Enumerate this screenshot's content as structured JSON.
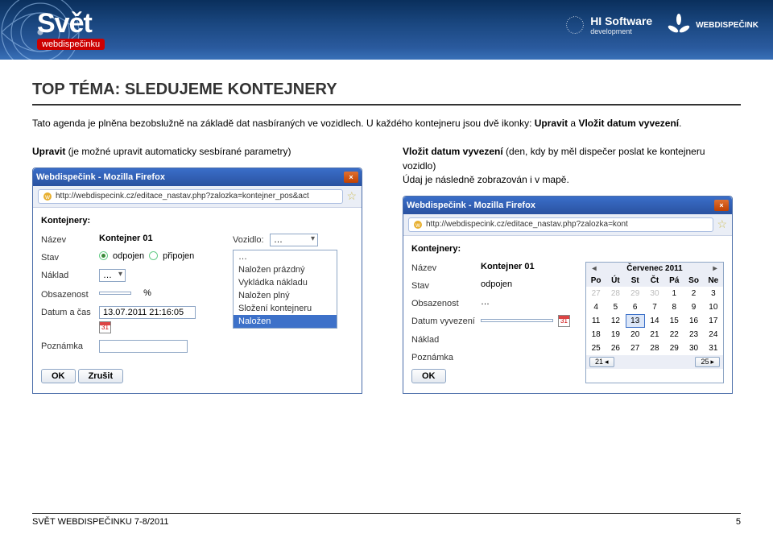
{
  "banner": {
    "brand_main": "Svět",
    "brand_sub": "webdispečinku",
    "hi_software": "HI Software",
    "hi_software_sub": "development",
    "webdispecink": "WEBDISPEČINK"
  },
  "page": {
    "title": "TOP TÉMA: SLEDUJEME KONTEJNERY",
    "intro_1": "Tato agenda je plněna bezobslužně na základě dat nasbíraných ve vozidlech. U každého kontejneru jsou dvě ikonky: ",
    "intro_b1": "Upravit",
    "intro_mid": " a ",
    "intro_b2": "Vložit datum vyvezení",
    "intro_end": "."
  },
  "left": {
    "heading_b": "Upravit",
    "heading_rest": " (je možné upravit automaticky sesbírané parametry)",
    "window_title": "Webdispečink - Mozilla Firefox",
    "url": "http://webdispecink.cz/editace_nastav.php?zalozka=kontejner_pos&act",
    "section": "Kontejnery:",
    "labels": {
      "nazev": "Název",
      "vozidlo": "Vozidlo:",
      "stav": "Stav",
      "naklad": "Náklad",
      "obsazenost": "Obsazenost",
      "datum": "Datum a čas",
      "poznamka": "Poznámka"
    },
    "values": {
      "nazev": "Kontejner 01",
      "vozidlo_selected": "…",
      "stav_odpojen": "odpojen",
      "stav_pripojen": "připojen",
      "naklad_selected": "…",
      "percent": "%",
      "datum": "13.07.2011 21:16:05"
    },
    "naklad_options": [
      "…",
      "Naložen prázdný",
      "Vykládka nákladu",
      "Naložen plný",
      "Složení kontejneru",
      "Naložen"
    ],
    "buttons": {
      "ok": "OK",
      "cancel": "Zrušit"
    }
  },
  "right": {
    "heading_b": "Vložit datum vyvezení",
    "heading_rest": " (den, kdy by měl dispečer poslat ke kontejneru vozidlo)",
    "heading_line2": "Údaj je následně zobrazován i v mapě.",
    "window_title": "Webdispečink - Mozilla Firefox",
    "url": "http://webdispecink.cz/editace_nastav.php?zalozka=kont",
    "section": "Kontejnery:",
    "labels": {
      "nazev": "Název",
      "stav": "Stav",
      "obsazenost": "Obsazenost",
      "datum": "Datum vyvezení",
      "naklad": "Náklad",
      "poznamka": "Poznámka"
    },
    "values": {
      "nazev": "Kontejner 01",
      "stav": "odpojen",
      "obsazenost": "…"
    },
    "buttons": {
      "ok": "OK"
    },
    "calendar": {
      "title": "Červenec 2011",
      "dow": [
        "Po",
        "Út",
        "St",
        "Čt",
        "Pá",
        "So",
        "Ne"
      ],
      "days": [
        {
          "n": 27,
          "out": true
        },
        {
          "n": 28,
          "out": true
        },
        {
          "n": 29,
          "out": true
        },
        {
          "n": 30,
          "out": true
        },
        {
          "n": 1
        },
        {
          "n": 2
        },
        {
          "n": 3
        },
        {
          "n": 4
        },
        {
          "n": 5
        },
        {
          "n": 6
        },
        {
          "n": 7
        },
        {
          "n": 8
        },
        {
          "n": 9
        },
        {
          "n": 10
        },
        {
          "n": 11
        },
        {
          "n": 12
        },
        {
          "n": 13,
          "today": true
        },
        {
          "n": 14
        },
        {
          "n": 15
        },
        {
          "n": 16
        },
        {
          "n": 17
        },
        {
          "n": 18
        },
        {
          "n": 19
        },
        {
          "n": 20
        },
        {
          "n": 21
        },
        {
          "n": 22
        },
        {
          "n": 23
        },
        {
          "n": 24
        },
        {
          "n": 25
        },
        {
          "n": 26
        },
        {
          "n": 27
        },
        {
          "n": 28
        },
        {
          "n": 29
        },
        {
          "n": 30
        },
        {
          "n": 31
        }
      ],
      "foot_left": "21",
      "foot_right": "25"
    }
  },
  "footer": {
    "text": "SVĚT WEBDISPEČINKU 7-8/2011",
    "page": "5"
  }
}
